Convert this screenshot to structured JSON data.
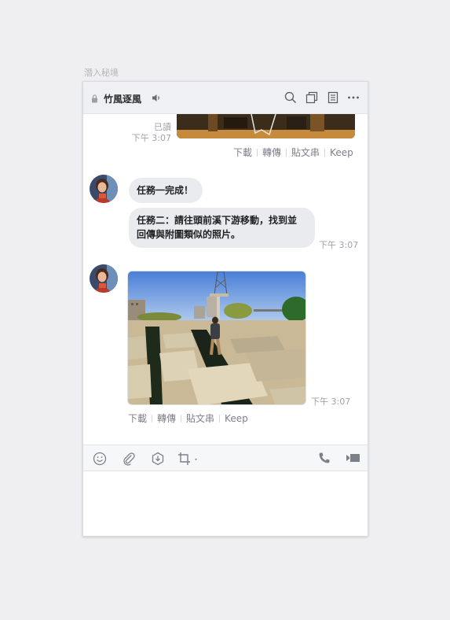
{
  "caption": "潛入秘境",
  "header": {
    "title": "竹風逐風",
    "icons": [
      "lock-icon",
      "speaker-icon",
      "search-icon",
      "copy-icon",
      "notes-icon",
      "more-icon"
    ]
  },
  "messages": {
    "prev": {
      "read": "已讀",
      "time": "下午 3:07",
      "actions": [
        "下載",
        "轉傳",
        "貼文串",
        "Keep"
      ]
    },
    "msg1": {
      "text": "任務一完成！"
    },
    "msg2": {
      "line1": "任務二：請往頭前溪下游移動，找到並",
      "line2": "回傳與附圖類似的照片。",
      "time": "下午 3:07"
    },
    "photo": {
      "time": "下午 3:07",
      "actions": [
        "下載",
        "轉傳",
        "貼文串",
        "Keep"
      ]
    }
  },
  "toolbar": {
    "icons": [
      "emoji-icon",
      "attach-icon",
      "download-icon",
      "crop-icon",
      "call-icon",
      "video-icon"
    ]
  },
  "colors": {
    "accent": "#7c8088",
    "bubble": "#e9ebef",
    "header": "#eef0f4"
  }
}
